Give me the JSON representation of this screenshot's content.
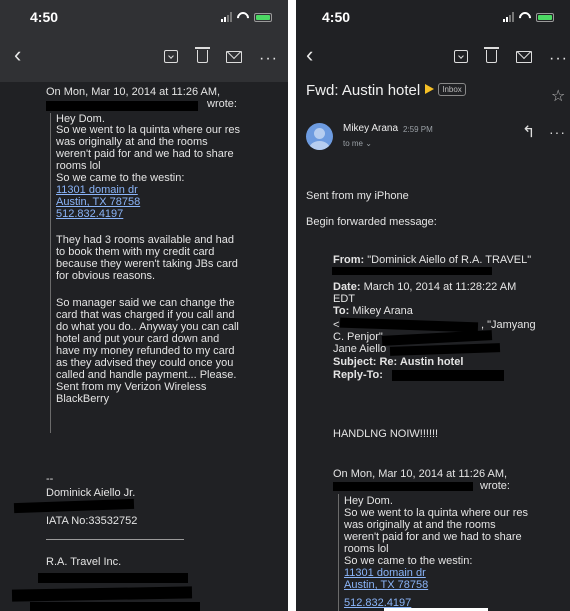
{
  "status": {
    "time": "4:50"
  },
  "left": {
    "quote_header_1": "On Mon, Mar 10, 2014 at 11:26 AM,",
    "wrote": "wrote:",
    "body": [
      "Hey Dom.",
      "So we went to la quinta where our res",
      "was originally at and the rooms",
      "weren't paid for and we had to share",
      "rooms lol",
      "So we came to the westin:"
    ],
    "links": [
      "11301 domain dr",
      "Austin, TX 78758",
      "512.832.4197"
    ],
    "para2": [
      "They had 3 rooms available and had",
      "to book them with my credit card",
      "because they weren't taking JBs card",
      "for obvious reasons."
    ],
    "para3": [
      "So manager said we can change the",
      "card that was charged if you call and",
      "do what you do.. Anyway you can call",
      "hotel and put your card down and",
      "have my money refunded to my card",
      "as they advised they could once you",
      "called and handle payment... Please.",
      "Sent from my Verizon Wireless",
      "BlackBerry"
    ],
    "sig_dashes": "--",
    "sig_name": "Dominick Aiello Jr.",
    "sig_iata": "IATA No:33532752",
    "sig_company": "R.A. Travel Inc."
  },
  "right": {
    "subject": "Fwd: Austin hotel",
    "label_chip": "Inbox",
    "sender_name": "Mikey Arana",
    "sent_time": "2:59 PM",
    "to_line": "to me ⌄",
    "sent_from": "Sent from my iPhone",
    "begin_fwd": "Begin forwarded message:",
    "from_label": "From:",
    "from_value": "\"Dominick Aiello of R.A. TRAVEL\"",
    "date_label": "Date:",
    "date_value": "March 10, 2014 at 11:28:22 AM",
    "date_tz": "EDT",
    "to_label": "To:",
    "to_value": "Mikey Arana",
    "to_extra_1": "<",
    "to_extra_2": ", \"Jamyang",
    "to_extra_3": "C. Penjor\"",
    "to_extra_4": "Jane Aiello",
    "subject_label": "Subject:",
    "subject_value": "Re:  Austin hotel",
    "replyto_label": "Reply-To:",
    "handling": "HANDLNG NOIW!!!!!!",
    "quote_header_1": "On Mon, Mar 10, 2014 at 11:26 AM,",
    "wrote": "wrote:",
    "body": [
      "Hey Dom.",
      "So we went to la quinta where our res",
      "was originally at and the rooms",
      "weren't paid for and we had to share",
      "rooms lol",
      "So we came to the westin:"
    ],
    "links": [
      "11301 domain dr",
      "Austin, TX 78758",
      "512.832.4197"
    ]
  }
}
